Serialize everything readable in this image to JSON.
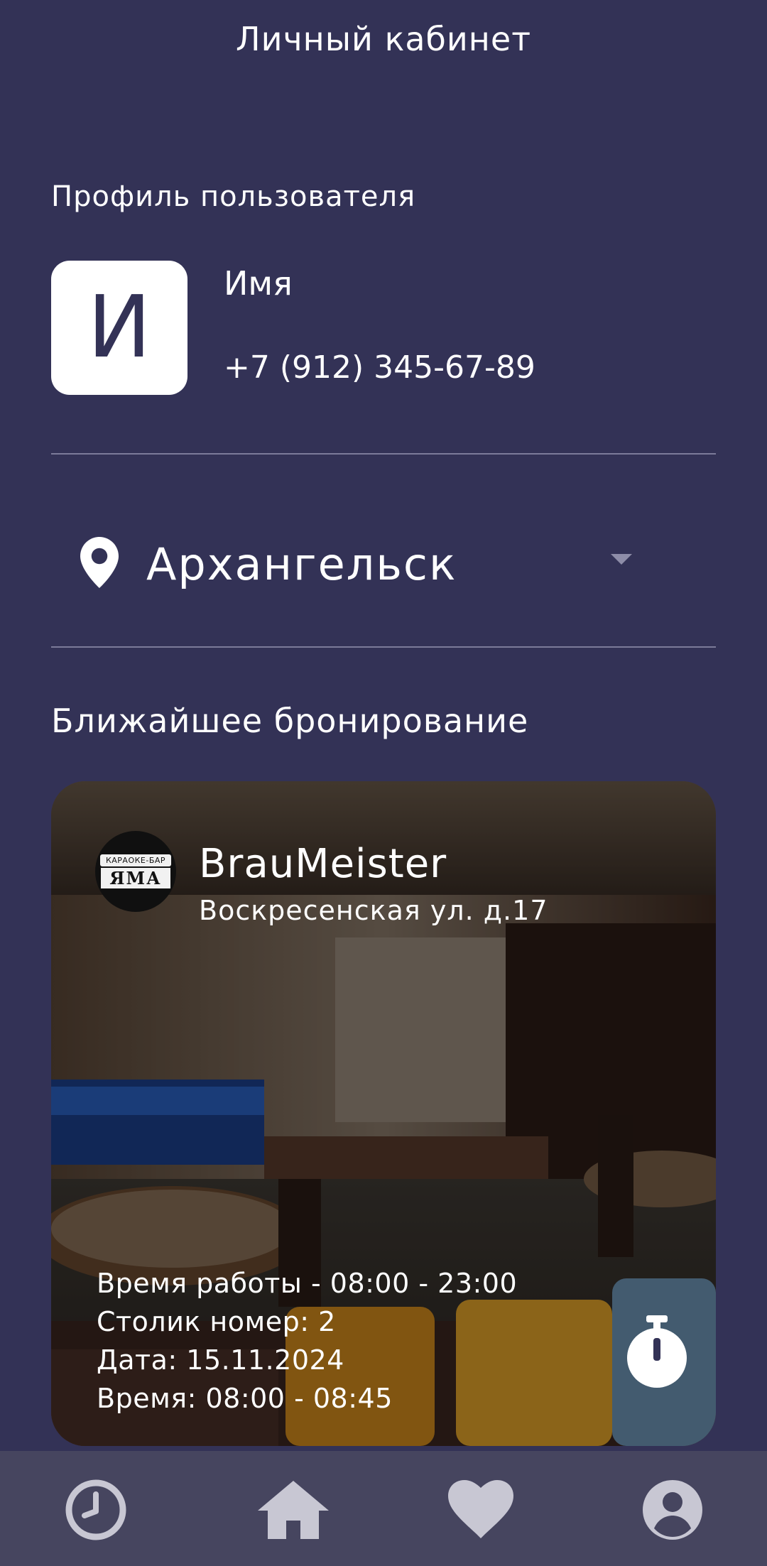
{
  "header": {
    "title": "Личный кабинет"
  },
  "profile": {
    "heading": "Профиль пользователя",
    "avatar_letter": "И",
    "name": "Имя",
    "phone": "+7 (912) 345-67-89"
  },
  "city_select": {
    "selected": "Архангельск",
    "icon": "location-pin-icon"
  },
  "booking": {
    "heading": "Ближайшее бронирование",
    "venue": {
      "name": "BrauMeister",
      "address": "Воскресенская ул. д.17",
      "logo_ribbon": "КАРАОКЕ-БАР",
      "logo_mark": "ЯМА"
    },
    "details": {
      "hours": "Время работы - 08:00 - 23:00",
      "table": "Столик номер: 2",
      "date": "Дата: 15.11.2024",
      "time": "Время: 08:00 - 08:45"
    }
  },
  "bottom_nav": {
    "items": [
      {
        "icon": "clock-icon"
      },
      {
        "icon": "home-icon"
      },
      {
        "icon": "heart-icon"
      },
      {
        "icon": "account-icon"
      }
    ]
  },
  "colors": {
    "background": "#333256",
    "nav_background": "#46455f",
    "divider": "#7c7b99",
    "icon_muted": "#c8c7d3"
  }
}
